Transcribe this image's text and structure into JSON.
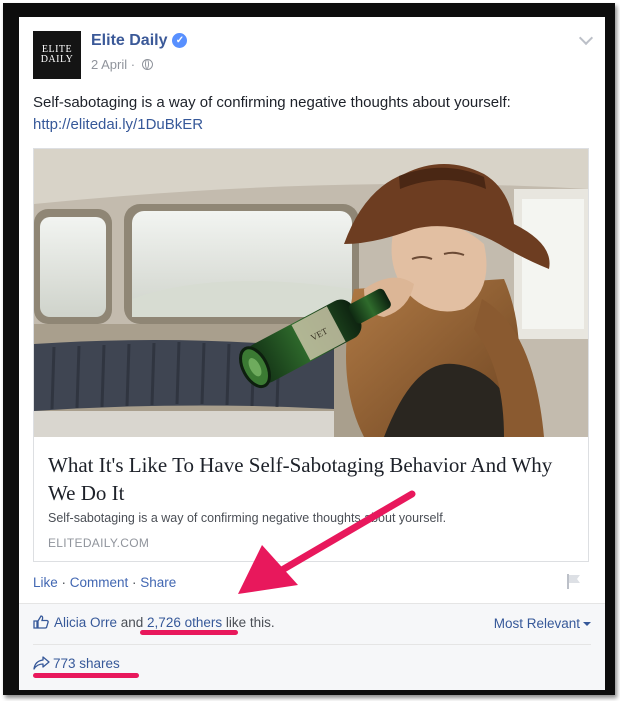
{
  "post": {
    "page_name": "Elite Daily",
    "logo_line1": "ELITE",
    "logo_line2": "DAILY",
    "date": "2 April",
    "meta_separator": "·",
    "text": "Self-sabotaging is a way of confirming negative thoughts about yourself:",
    "link": "http://elitedai.ly/1DuBkER"
  },
  "attachment": {
    "title": "What It's Like To Have Self-Sabotaging Behavior And Why We Do It",
    "description": "Self-sabotaging is a way of confirming negative thoughts about yourself.",
    "domain": "ELITEDAILY.COM",
    "bottle_label": "VET"
  },
  "actions": {
    "like": "Like",
    "comment": "Comment",
    "share": "Share",
    "separator": " · "
  },
  "reactions": {
    "first_name": "Alicia Orre",
    "and_text": " and ",
    "others": "2,726 others",
    "like_this": " like this.",
    "sort_label": "Most Relevant"
  },
  "shares": {
    "label": "773 shares"
  },
  "colors": {
    "annotation": "#e8185c",
    "facebook_blue": "#365899"
  }
}
